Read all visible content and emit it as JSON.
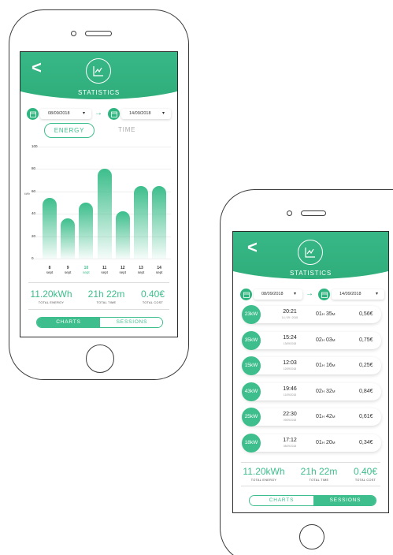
{
  "app": {
    "title": "STATISTICS",
    "accent_color": "#3dbe8c",
    "back_icon": "chevron-left-icon",
    "logo_icon": "line-chart-icon",
    "calendar_icon": "calendar-icon"
  },
  "date_range": {
    "from": "08/09/2018",
    "to": "14/09/2018",
    "dropdown_glyph": "▾",
    "arrow": "→"
  },
  "screen1": {
    "toggle": {
      "energy": "ENERGY",
      "time": "TIME"
    },
    "y_unit": "kWh",
    "chart_data": {
      "type": "bar",
      "categories": [
        "8 sept",
        "9 sept",
        "10 sept",
        "11 sept",
        "12 sept",
        "13 sept",
        "14 sept"
      ],
      "day_numbers": [
        "8",
        "9",
        "10",
        "11",
        "12",
        "13",
        "14"
      ],
      "month_label": "sept",
      "selected_index": 2,
      "values": [
        54,
        36,
        50,
        80,
        42,
        65,
        65
      ],
      "ylim": [
        0,
        100
      ],
      "yticks": [
        "100",
        "80",
        "60",
        "40",
        "20",
        "0"
      ]
    },
    "totals": {
      "energy": "11.20kWh",
      "energy_label": "TOTAL ENERGY",
      "time": "21h 22m",
      "time_label": "TOTAL TIME",
      "cost": "0.40€",
      "cost_label": "TOTAL COST"
    },
    "tabs": {
      "charts": "CHARTS",
      "sessions": "SESSIONS",
      "active": "charts"
    }
  },
  "screen2": {
    "sessions": [
      {
        "power": "23kW",
        "time": "20:21",
        "date": "14 / 09 / 2018",
        "duration_h": "01",
        "duration_m": "35",
        "cost": "0,56€"
      },
      {
        "power": "35kW",
        "time": "15:24",
        "date": "13/09/2018",
        "duration_h": "02",
        "duration_m": "03",
        "cost": "0,75€"
      },
      {
        "power": "15kW",
        "time": "12:03",
        "date": "12/09/2018",
        "duration_h": "01",
        "duration_m": "16",
        "cost": "0,25€"
      },
      {
        "power": "43kW",
        "time": "19:46",
        "date": "11/09/2018",
        "duration_h": "02",
        "duration_m": "32",
        "cost": "0,84€"
      },
      {
        "power": "25kW",
        "time": "22:30",
        "date": "09/09/2018",
        "duration_h": "01",
        "duration_m": "42",
        "cost": "0,61€"
      },
      {
        "power": "18kW",
        "time": "17:12",
        "date": "08/09/2018",
        "duration_h": "01",
        "duration_m": "20",
        "cost": "0,34€"
      }
    ],
    "h_unit": "H",
    "m_unit": "M",
    "totals": {
      "energy": "11.20kWh",
      "energy_label": "TOTAL ENERGY",
      "time": "21h 22m",
      "time_label": "TOTAL TIME",
      "cost": "0.40€",
      "cost_label": "TOTAL COST"
    },
    "tabs": {
      "charts": "CHARTS",
      "sessions": "SESSIONS",
      "active": "sessions"
    }
  }
}
